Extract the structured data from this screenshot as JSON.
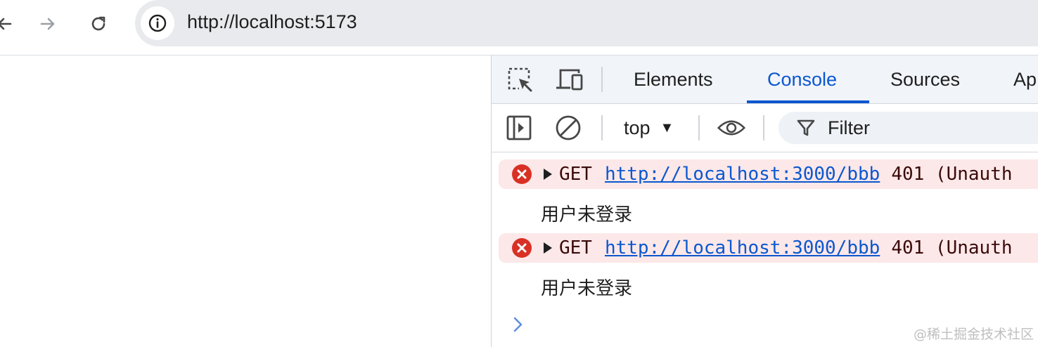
{
  "browser": {
    "url": "http://localhost:5173"
  },
  "icons": {
    "back": "arrow-left-icon",
    "forward": "arrow-right-icon",
    "reload": "reload-icon",
    "site_info": "info-icon",
    "inspect": "inspect-element-icon",
    "device": "device-toolbar-icon",
    "sidebar": "sidebar-toggle-icon",
    "clear": "clear-console-icon",
    "live_expression": "eye-icon",
    "filter": "filter-icon",
    "error": "error-icon",
    "prompt": "chevron-right-icon"
  },
  "devtools": {
    "tabs": [
      {
        "label": "Elements",
        "active": false
      },
      {
        "label": "Console",
        "active": true
      },
      {
        "label": "Sources",
        "active": false
      },
      {
        "label": "Ap",
        "active": false
      }
    ],
    "context": "top",
    "filter_placeholder": "Filter"
  },
  "console": {
    "entries": [
      {
        "type": "error",
        "method": "GET",
        "url": "http://localhost:3000/bbb",
        "status": "401 (Unauth"
      },
      {
        "type": "log",
        "text": "用户未登录"
      },
      {
        "type": "error",
        "method": "GET",
        "url": "http://localhost:3000/bbb",
        "status": "401 (Unauth"
      },
      {
        "type": "log",
        "text": "用户未登录"
      }
    ]
  },
  "colors": {
    "accent": "#0b57d0",
    "error_bg": "#fce8e8",
    "error_icon": "#d93025"
  },
  "watermark": "@稀土掘金技术社区"
}
